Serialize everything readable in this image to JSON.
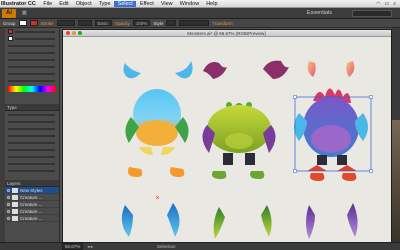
{
  "menubar": {
    "app": "Illustrator CC",
    "items": [
      "File",
      "Edit",
      "Object",
      "Type",
      "Select",
      "Effect",
      "View",
      "Window",
      "Help"
    ],
    "active_item": "Select"
  },
  "appbar": {
    "logo": "Ai",
    "workspace": "Essentials"
  },
  "control": {
    "selection_label": "Group",
    "stroke_label": "Stroke",
    "brush_value": "Basic",
    "opacity_label": "Opacity",
    "opacity_value": "100%",
    "style_label": "Style",
    "transform_label": "Transform",
    "fill_color": "#ffffff",
    "stroke_color": "#cc3322"
  },
  "document": {
    "title": "Monsters.ai* @ 66.67% (RGB/Preview)"
  },
  "layers": [
    {
      "name": "New Styles",
      "selected": true
    },
    {
      "name": "Creature ...",
      "selected": false
    },
    {
      "name": "Creature ...",
      "selected": false
    },
    {
      "name": "Creature ...",
      "selected": false
    },
    {
      "name": "Creature ...",
      "selected": false
    }
  ],
  "panels": {
    "type_tab": "Type",
    "layers_tab": "Layers"
  },
  "status": {
    "zoom": "66.67%",
    "tool": "Selection"
  },
  "colors": {
    "accent_orange": "#e0934b",
    "selection_blue": "#3b6fd6",
    "artboard": "#e9e8e2"
  }
}
